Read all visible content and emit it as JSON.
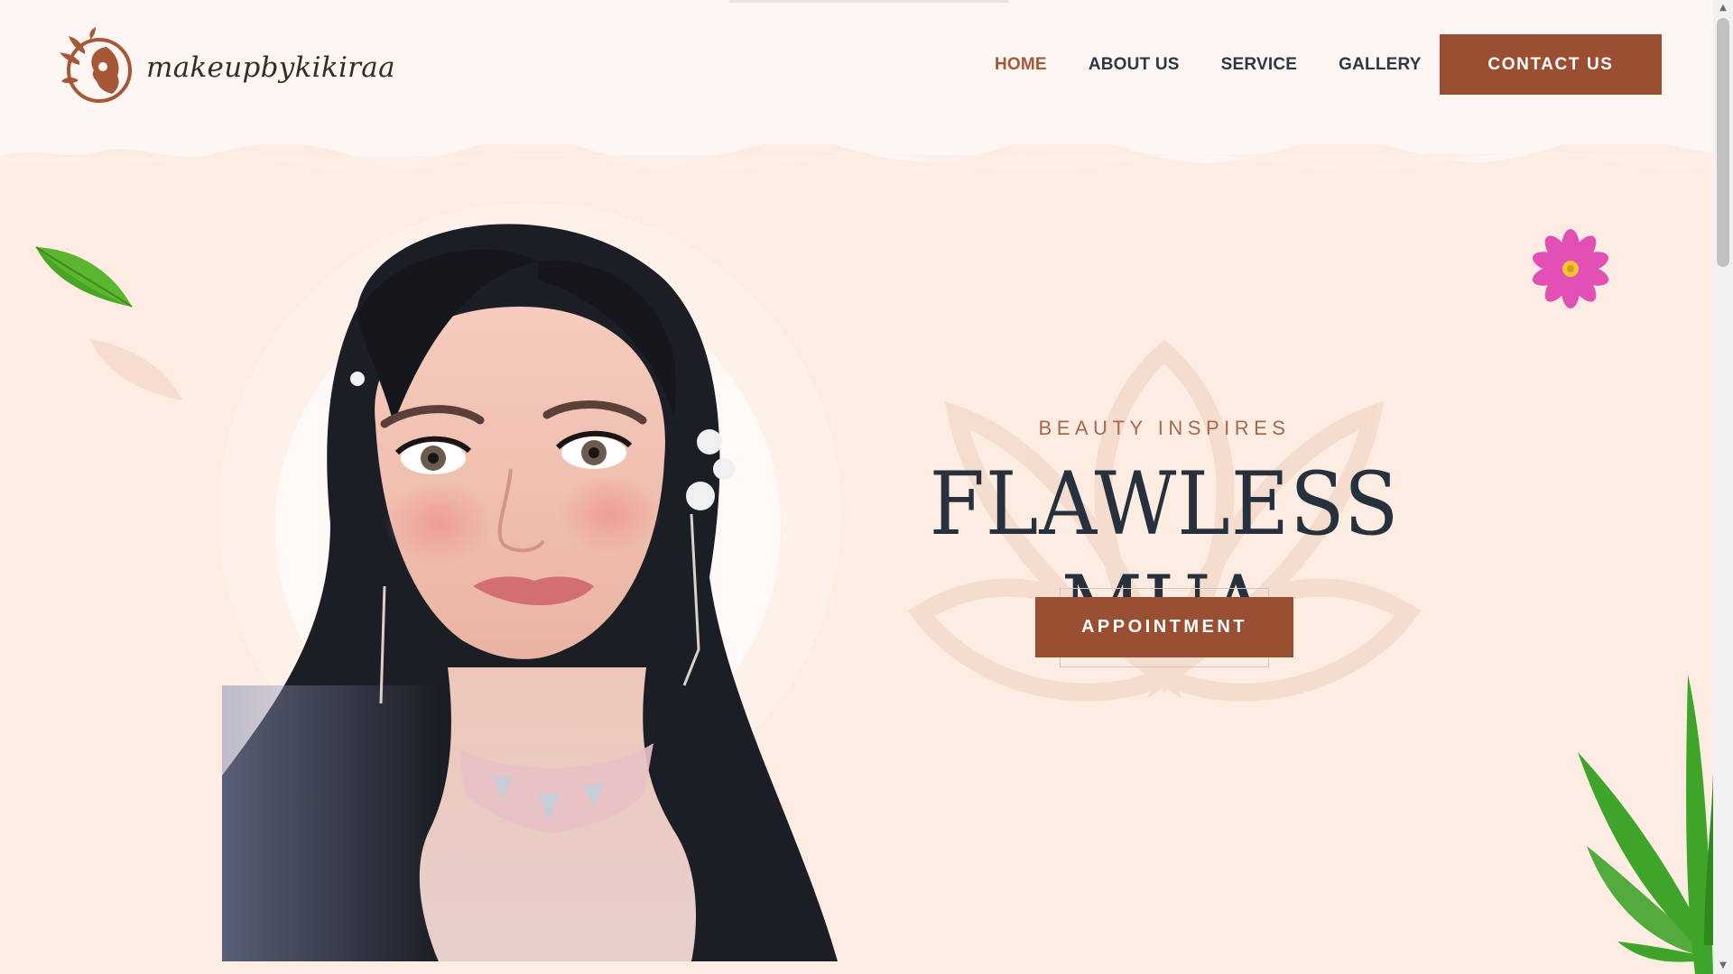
{
  "brand": {
    "name": "makeupbykikiraa"
  },
  "nav": {
    "items": [
      {
        "label": "HOME",
        "active": true
      },
      {
        "label": "ABOUT US",
        "active": false
      },
      {
        "label": "SERVICE",
        "active": false
      },
      {
        "label": "GALLERY",
        "active": false
      }
    ],
    "contact_label": "CONTACT US"
  },
  "hero": {
    "eyebrow": "BEAUTY INSPIRES",
    "title": "FLAWLESS MUA",
    "cta_label": "APPOINTMENT"
  },
  "icons": {
    "logo": "lotus-face-logo-icon",
    "leaf": "leaf-icon",
    "flower": "flower-icon",
    "plant": "cannabis-leaf-icon",
    "scroll_up": "chevron-up-icon",
    "scroll_down": "chevron-down-icon"
  },
  "colors": {
    "accent": "#9a4f33",
    "nav_active": "#a65737",
    "text_dark": "#26313d",
    "background": "#fdece2",
    "header_background": "#fdf6f3"
  },
  "scroll": {
    "position_fraction": 0.0
  }
}
